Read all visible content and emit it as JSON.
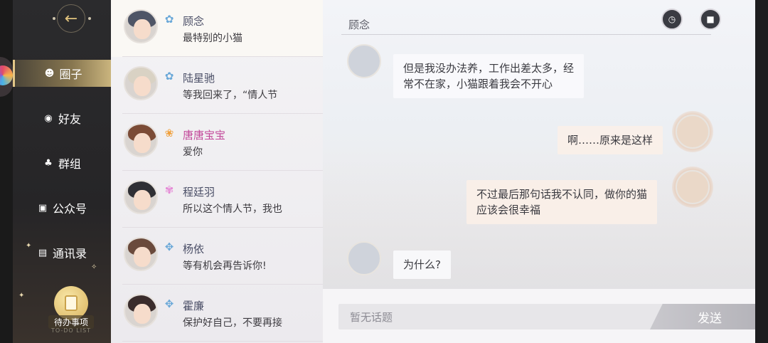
{
  "sidebar": {
    "back_label": "←",
    "nav": [
      {
        "label": "圈子",
        "icon": "chat-smile-icon",
        "active": true
      },
      {
        "label": "好友",
        "icon": "friend-icon",
        "active": false
      },
      {
        "label": "群组",
        "icon": "group-icon",
        "active": false
      },
      {
        "label": "公众号",
        "icon": "image-icon",
        "active": false
      },
      {
        "label": "通讯录",
        "icon": "contacts-book-icon",
        "active": false
      }
    ],
    "todo_label": "待办事项",
    "todo_sub": "TO-DO LIST"
  },
  "contacts": [
    {
      "name": "顾念",
      "message": "最特别的小猫",
      "badge": "ribbon-blue-icon",
      "name_color": "#4a4e66",
      "hair": "#4e5566"
    },
    {
      "name": "陆星驰",
      "message": "等我回来了，“情人节",
      "badge": "ribbon-blue-icon",
      "name_color": "#4a4e66",
      "hair": "#d9d2c4"
    },
    {
      "name": "唐唐宝宝",
      "message": "爱你",
      "badge": "heart-box-icon",
      "name_color": "#c2489a",
      "hair": "#7b4b36"
    },
    {
      "name": "程廷羽",
      "message": "所以这个情人节，我也",
      "badge": "flower-icon",
      "name_color": "#4a4e66",
      "hair": "#2f2f34"
    },
    {
      "name": "杨依",
      "message": "等有机会再告诉你!",
      "badge": "handshake-icon",
      "name_color": "#4a4e66",
      "hair": "#6a4a3c"
    },
    {
      "name": "霍廉",
      "message": "保护好自己，不要再接",
      "badge": "handshake-icon",
      "name_color": "#4a4e66",
      "hair": "#3a2c2c"
    }
  ],
  "chat": {
    "title": "顾念",
    "messages": [
      {
        "side": "in",
        "text_line1": "但是我没办法养，工作出差太多，经",
        "text_line2": "常不在家，小猫跟着我会不开心"
      },
      {
        "side": "out",
        "text_line1": "啊……原来是这样"
      },
      {
        "side": "out",
        "text_line1": "不过最后那句话我不认同，做你的猫",
        "text_line2": "应该会很幸福"
      },
      {
        "side": "in",
        "text_line1": "为什么?"
      }
    ],
    "input_placeholder": "暂无话题",
    "send_label": "发送"
  },
  "colors": {
    "accent_gold": "#e3c788",
    "pink_name": "#c2489a"
  }
}
